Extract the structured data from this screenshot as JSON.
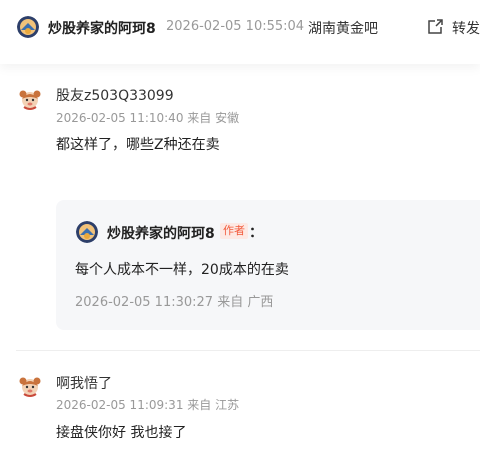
{
  "header": {
    "author": "炒股养家的阿珂8",
    "time": "2026-02-05 10:55:04",
    "bar": "湖南黄金吧",
    "share_label": "转发"
  },
  "comments": [
    {
      "user": "股友z503Q33099",
      "meta": "2026-02-05 11:10:40   来自 安徽",
      "text": "都这样了，哪些Z种还在卖",
      "reply": {
        "author": "炒股养家的阿珂8",
        "badge": "作者",
        "colon": "：",
        "text": "每个人成本不一样，20成本的在卖",
        "meta": "2026-02-05 11:30:27   来自 广西"
      }
    },
    {
      "user": "啊我悟了",
      "meta": "2026-02-05 11:09:31   来自 江苏",
      "text": "接盘侠你好 我也接了"
    }
  ],
  "colors": {
    "author_badge": "#f25a3b",
    "meta_gray": "#999999"
  },
  "icons": [
    "author-avatar-icon",
    "share-icon",
    "user-avatar-icon"
  ]
}
